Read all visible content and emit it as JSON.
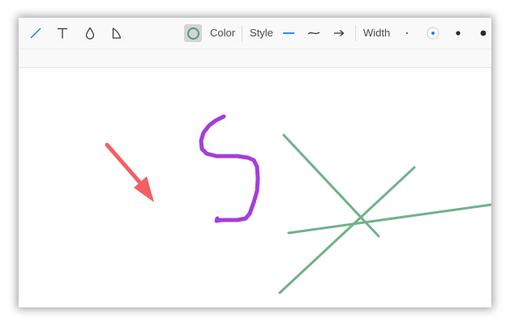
{
  "toolbar": {
    "tools": [
      {
        "name": "line-tool",
        "icon": "line-icon",
        "active": true
      },
      {
        "name": "text-tool",
        "icon": "text-T-icon",
        "active": false
      },
      {
        "name": "highlight-tool",
        "icon": "droplet-icon",
        "active": false
      },
      {
        "name": "shape-tool",
        "icon": "freehand-shape-icon",
        "active": false
      }
    ],
    "color_label": "Color",
    "current_color": "#5c9a74",
    "style_label": "Style",
    "styles": [
      {
        "name": "straight-line",
        "icon": "straight-line-icon",
        "active": true
      },
      {
        "name": "curved-line",
        "icon": "curve-icon",
        "active": false
      },
      {
        "name": "arrow-line",
        "icon": "arrow-icon",
        "active": false
      }
    ],
    "width_label": "Width",
    "widths": [
      {
        "name": "width-thin",
        "active": false
      },
      {
        "name": "width-medium",
        "active": true
      },
      {
        "name": "width-thick",
        "active": false
      },
      {
        "name": "width-thicker",
        "active": false
      }
    ],
    "accent_color": "#0a84ff"
  },
  "canvas": {
    "strokes": [
      {
        "kind": "arrow",
        "color": "#f16063"
      },
      {
        "kind": "freehand",
        "color": "#a53ddb"
      },
      {
        "kind": "line",
        "color": "#6fb28a"
      },
      {
        "kind": "line",
        "color": "#6fb28a"
      },
      {
        "kind": "line",
        "color": "#6fb28a"
      }
    ]
  }
}
